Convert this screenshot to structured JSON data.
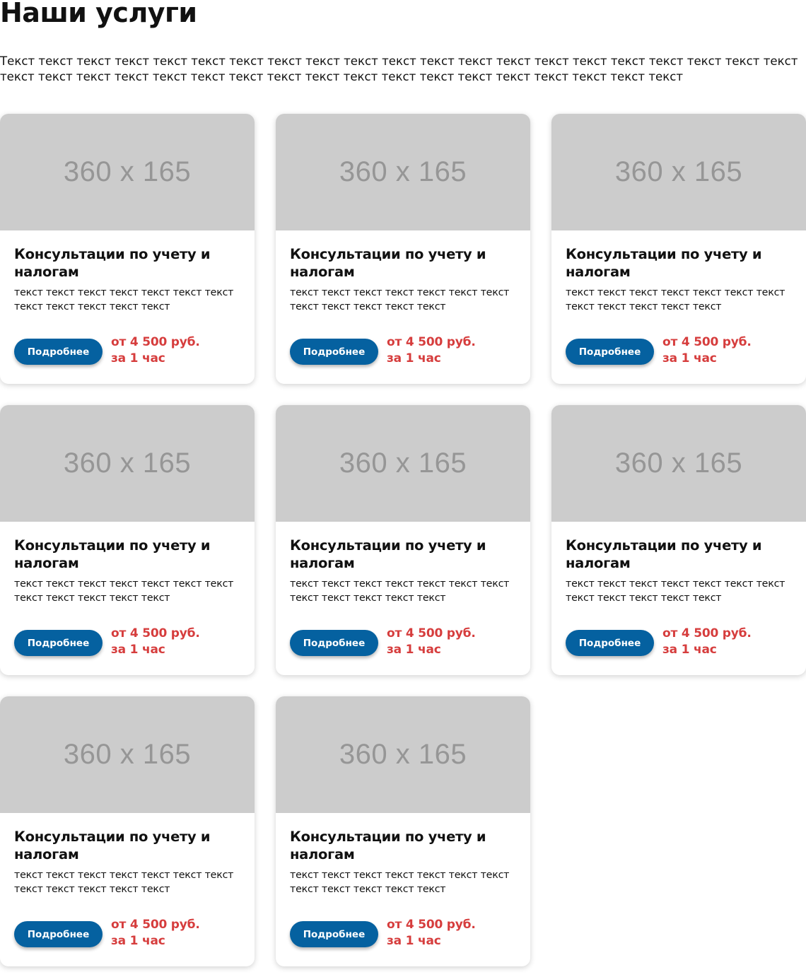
{
  "page": {
    "title": "Наши услуги",
    "intro": "Текст текст текст текст текст текст текст текст текст текст текст текст текст текст текст текст текст текст текст текст текст текст текст текст текст текст текст текст текст текст текст текст текст текст текст текст текст текст текст"
  },
  "cards": [
    {
      "image_label": "360 x 165",
      "title": "Консультации по учету и налогам",
      "text": "текст текст текст текст текст текст текст текст текст текст текст текст",
      "button": "Подробнее",
      "price_line1": "от 4 500 руб.",
      "price_line2": "за 1 час"
    },
    {
      "image_label": "360 x 165",
      "title": "Консультации по учету и налогам",
      "text": "текст текст текст текст текст текст текст текст текст текст текст текст",
      "button": "Подробнее",
      "price_line1": "от 4 500 руб.",
      "price_line2": "за 1 час"
    },
    {
      "image_label": "360 x 165",
      "title": "Консультации по учету и налогам",
      "text": "текст текст текст текст текст текст текст текст текст текст текст текст",
      "button": "Подробнее",
      "price_line1": "от 4 500 руб.",
      "price_line2": "за 1 час"
    },
    {
      "image_label": "360 x 165",
      "title": "Консультации по учету и налогам",
      "text": "текст текст текст текст текст текст текст текст текст текст текст текст",
      "button": "Подробнее",
      "price_line1": "от 4 500 руб.",
      "price_line2": "за 1 час"
    },
    {
      "image_label": "360 x 165",
      "title": "Консультации по учету и налогам",
      "text": "текст текст текст текст текст текст текст текст текст текст текст текст",
      "button": "Подробнее",
      "price_line1": "от 4 500 руб.",
      "price_line2": "за 1 час"
    },
    {
      "image_label": "360 x 165",
      "title": "Консультации по учету и налогам",
      "text": "текст текст текст текст текст текст текст текст текст текст текст текст",
      "button": "Подробнее",
      "price_line1": "от 4 500 руб.",
      "price_line2": "за 1 час"
    },
    {
      "image_label": "360 x 165",
      "title": "Консультации по учету и налогам",
      "text": "текст текст текст текст текст текст текст текст текст текст текст текст",
      "button": "Подробнее",
      "price_line1": "от 4 500 руб.",
      "price_line2": "за 1 час"
    },
    {
      "image_label": "360 x 165",
      "title": "Консультации по учету и налогам",
      "text": "текст текст текст текст текст текст текст текст текст текст текст текст",
      "button": "Подробнее",
      "price_line1": "от 4 500 руб.",
      "price_line2": "за 1 час"
    }
  ],
  "colors": {
    "button_bg": "#0561a0",
    "price": "#d63d3d",
    "placeholder_bg": "#cccccc",
    "placeholder_text": "#969696"
  }
}
